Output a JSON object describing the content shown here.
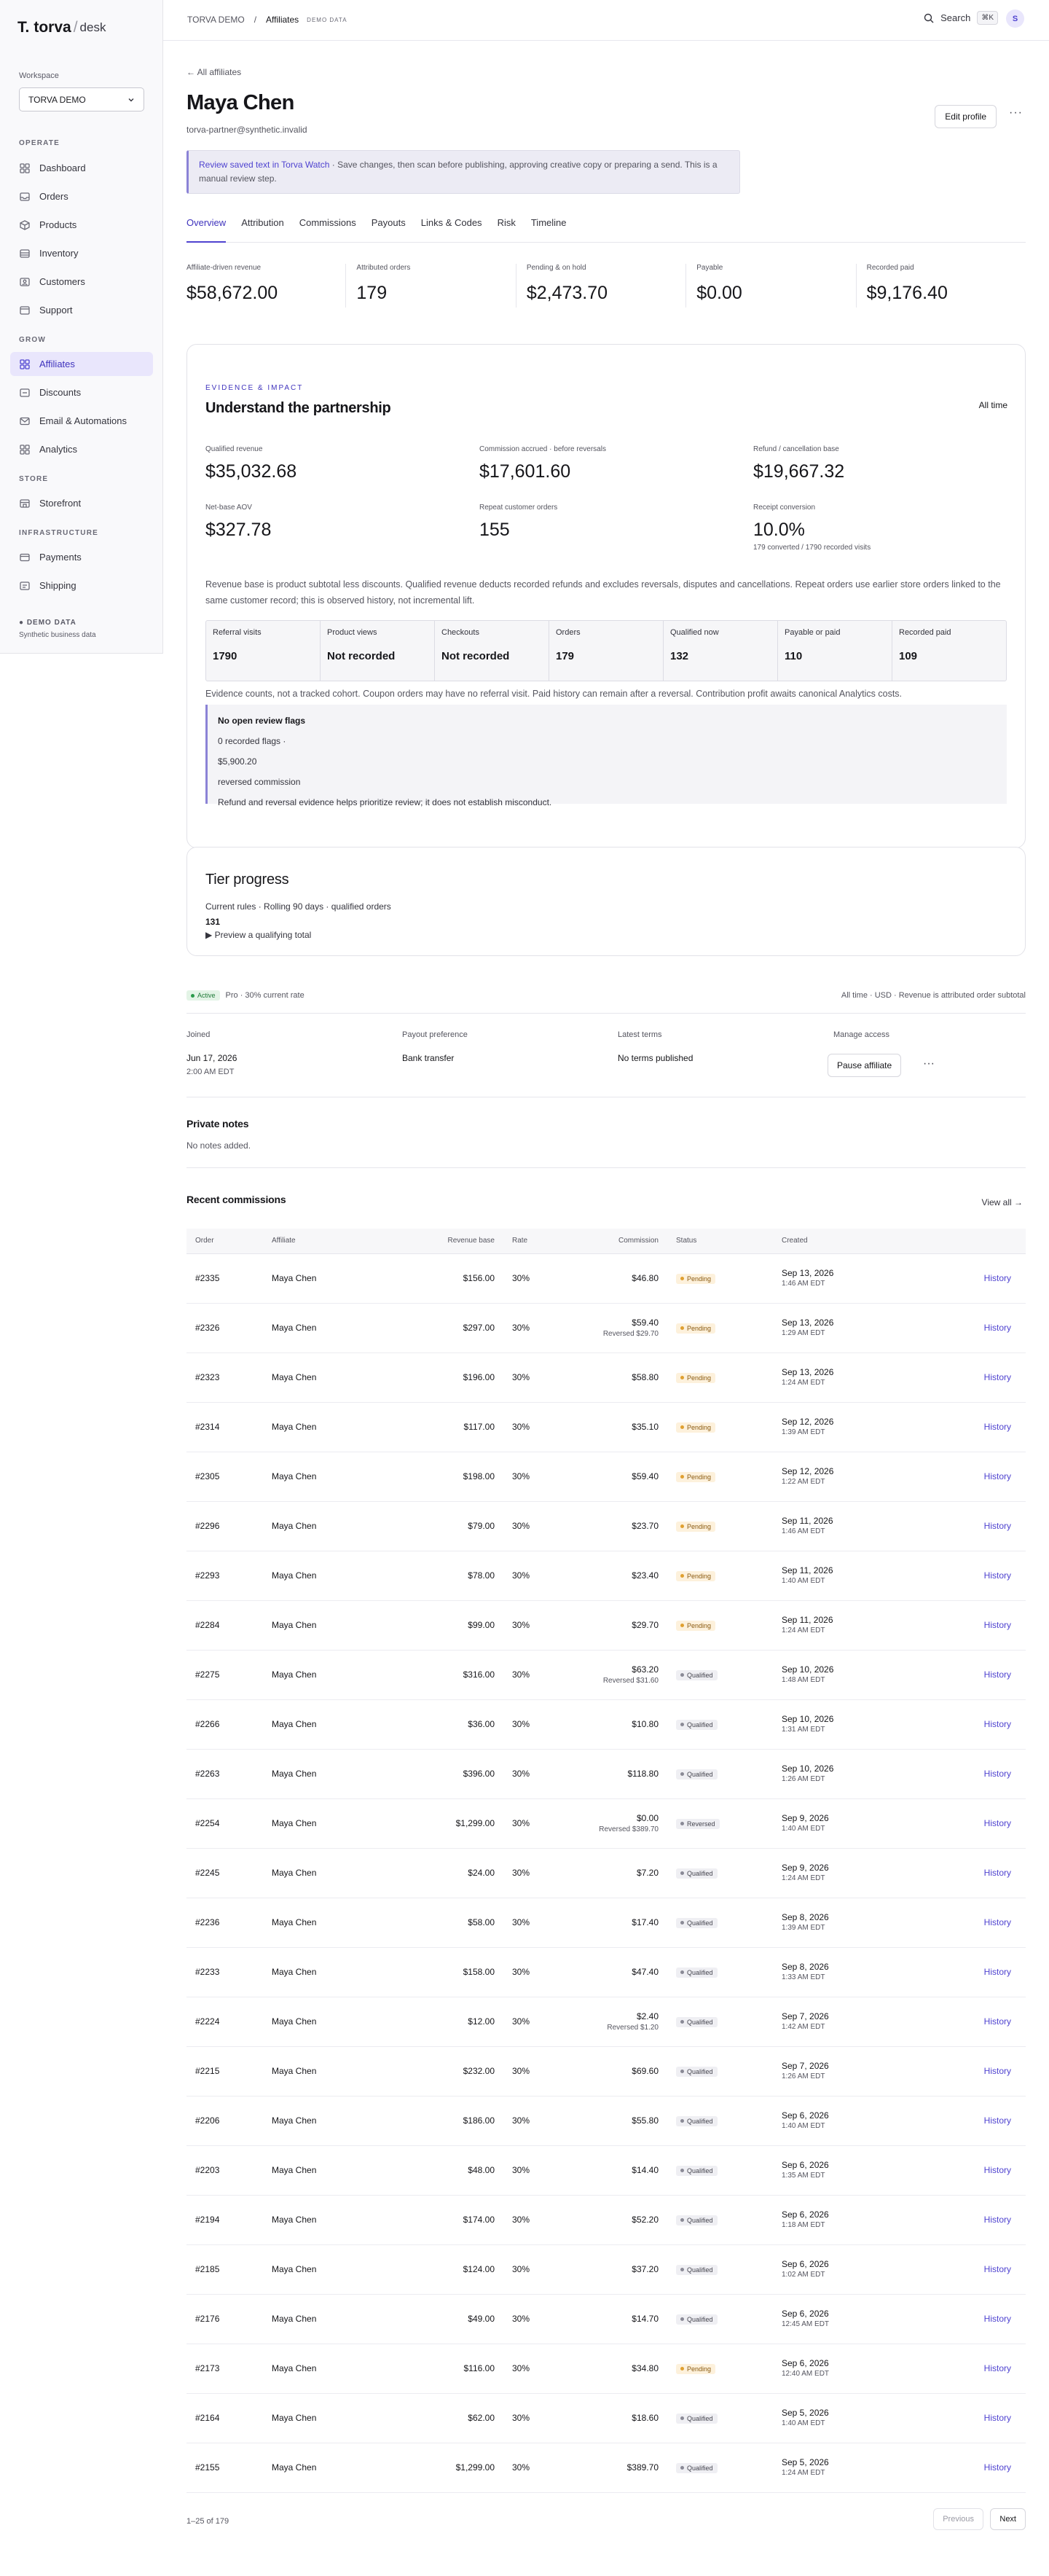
{
  "brand": {
    "mark": "T.",
    "name": "torva",
    "sep": "/",
    "product": "desk"
  },
  "workspace": {
    "label": "Workspace",
    "value": "TORVA DEMO"
  },
  "nav": {
    "operate": "OPERATE",
    "operate_items": [
      {
        "label": "Dashboard",
        "icon": "grid-icon"
      },
      {
        "label": "Orders",
        "icon": "inbox-icon"
      },
      {
        "label": "Products",
        "icon": "box-icon"
      },
      {
        "label": "Inventory",
        "icon": "layers-icon"
      },
      {
        "label": "Customers",
        "icon": "users-icon"
      },
      {
        "label": "Support",
        "icon": "support-icon"
      }
    ],
    "grow": "GROW",
    "grow_items": [
      {
        "label": "Affiliates",
        "icon": "grid-icon"
      },
      {
        "label": "Discounts",
        "icon": "tag-icon"
      },
      {
        "label": "Email & Automations",
        "icon": "mail-icon"
      },
      {
        "label": "Analytics",
        "icon": "chart-icon"
      }
    ],
    "store": "STORE",
    "store_items": [
      {
        "label": "Storefront",
        "icon": "store-icon"
      }
    ],
    "infra": "INFRASTRUCTURE",
    "infra_items": [
      {
        "label": "Payments",
        "icon": "card-icon"
      },
      {
        "label": "Shipping",
        "icon": "truck-icon"
      }
    ],
    "demo_badge": "● DEMO DATA",
    "demo_sub": "Synthetic business data"
  },
  "topbar": {
    "crumb_root": "TORVA DEMO",
    "crumb_sep": "/",
    "crumb_current": "Affiliates",
    "crumb_tag": "DEMO DATA",
    "search": "Search",
    "shortcut": "⌘K",
    "avatar": "S"
  },
  "profile": {
    "back": "← All affiliates",
    "name": "Maya Chen",
    "email": "torva-partner@synthetic.invalid",
    "edit": "Edit profile",
    "more": "···"
  },
  "notice": {
    "link": "Review saved text in Torva Watch",
    "text": " · Save changes, then scan before publishing, approving creative copy or preparing a send. This is a manual review step."
  },
  "tabs": [
    "Overview",
    "Attribution",
    "Commissions",
    "Payouts",
    "Links & Codes",
    "Risk",
    "Timeline"
  ],
  "stats": [
    {
      "label": "Affiliate-driven revenue",
      "value": "$58,672.00"
    },
    {
      "label": "Attributed orders",
      "value": "179"
    },
    {
      "label": "Pending & on hold",
      "value": "$2,473.70"
    },
    {
      "label": "Payable",
      "value": "$0.00"
    },
    {
      "label": "Recorded paid",
      "value": "$9,176.40"
    }
  ],
  "evidence": {
    "overline": "EVIDENCE & IMPACT",
    "title": "Understand the partnership",
    "range": "All time",
    "metrics": [
      {
        "label": "Qualified revenue",
        "value": "$35,032.68",
        "sub": ""
      },
      {
        "label": "Commission accrued · before reversals",
        "value": "$17,601.60",
        "sub": ""
      },
      {
        "label": "Refund / cancellation base",
        "value": "$19,667.32",
        "sub": ""
      },
      {
        "label": "Net-base AOV",
        "value": "$327.78",
        "sub": ""
      },
      {
        "label": "Repeat customer orders",
        "value": "155",
        "sub": ""
      },
      {
        "label": "Receipt conversion",
        "value": "10.0%",
        "sub": "179 converted / 1790 recorded visits"
      }
    ],
    "note": "Revenue base is product subtotal less discounts. Qualified revenue deducts recorded refunds and excludes reversals, disputes and cancellations. Repeat orders use earlier store orders linked to the same customer record; this is observed history, not incremental lift.",
    "funnel": [
      {
        "label": "Referral visits",
        "value": "1790"
      },
      {
        "label": "Product views",
        "value": "Not recorded"
      },
      {
        "label": "Checkouts",
        "value": "Not recorded"
      },
      {
        "label": "Orders",
        "value": "179"
      },
      {
        "label": "Qualified now",
        "value": "132"
      },
      {
        "label": "Payable or paid",
        "value": "110"
      },
      {
        "label": "Recorded paid",
        "value": "109"
      }
    ],
    "caveat": "Evidence counts, not a tracked cohort. Coupon orders may have no referral visit. Paid history can remain after a reversal. Contribution profit awaits canonical Analytics costs.",
    "review": {
      "title": "No open review flags",
      "flags": "0 recorded flags ·",
      "amount": "$5,900.20",
      "reversed": "reversed commission",
      "text": "Refund and reversal evidence helps prioritize review; it does not establish misconduct."
    }
  },
  "tier": {
    "title": "Tier progress",
    "rules": "Current rules · Rolling 90 days · qualified orders",
    "count": "131",
    "preview": "▶ Preview a qualifying total"
  },
  "status": {
    "badge": "Active",
    "plan": "Pro · 30% current rate",
    "right": "All time · USD · Revenue is attributed order subtotal"
  },
  "info": [
    {
      "label": "Joined",
      "value": "Jun 17, 2026",
      "value2": "2:00 AM EDT"
    },
    {
      "label": "Payout preference",
      "value": "Bank transfer",
      "value2": ""
    },
    {
      "label": "Latest terms",
      "value": "No terms published",
      "value2": ""
    },
    {
      "label": "Manage access",
      "value": "",
      "value2": ""
    }
  ],
  "pause": {
    "label": "Pause affiliate",
    "more": "···"
  },
  "notes": {
    "title": "Private notes",
    "empty": "No notes added."
  },
  "commissions": {
    "title": "Recent commissions",
    "view_all": "View all →",
    "headers": [
      "Order",
      "Affiliate",
      "Revenue base",
      "Rate",
      "Commission",
      "Status",
      "Created",
      ""
    ],
    "rows": [
      {
        "order": "#2335",
        "affiliate": "Maya Chen",
        "base": "$156.00",
        "rate": "30%",
        "commission": "$46.80",
        "reversed": "",
        "status": "Pending",
        "date": "Sep 13, 2026",
        "time": "1:46 AM EDT"
      },
      {
        "order": "#2326",
        "affiliate": "Maya Chen",
        "base": "$297.00",
        "rate": "30%",
        "commission": "$59.40",
        "reversed": "Reversed $29.70",
        "status": "Pending",
        "date": "Sep 13, 2026",
        "time": "1:29 AM EDT"
      },
      {
        "order": "#2323",
        "affiliate": "Maya Chen",
        "base": "$196.00",
        "rate": "30%",
        "commission": "$58.80",
        "reversed": "",
        "status": "Pending",
        "date": "Sep 13, 2026",
        "time": "1:24 AM EDT"
      },
      {
        "order": "#2314",
        "affiliate": "Maya Chen",
        "base": "$117.00",
        "rate": "30%",
        "commission": "$35.10",
        "reversed": "",
        "status": "Pending",
        "date": "Sep 12, 2026",
        "time": "1:39 AM EDT"
      },
      {
        "order": "#2305",
        "affiliate": "Maya Chen",
        "base": "$198.00",
        "rate": "30%",
        "commission": "$59.40",
        "reversed": "",
        "status": "Pending",
        "date": "Sep 12, 2026",
        "time": "1:22 AM EDT"
      },
      {
        "order": "#2296",
        "affiliate": "Maya Chen",
        "base": "$79.00",
        "rate": "30%",
        "commission": "$23.70",
        "reversed": "",
        "status": "Pending",
        "date": "Sep 11, 2026",
        "time": "1:46 AM EDT"
      },
      {
        "order": "#2293",
        "affiliate": "Maya Chen",
        "base": "$78.00",
        "rate": "30%",
        "commission": "$23.40",
        "reversed": "",
        "status": "Pending",
        "date": "Sep 11, 2026",
        "time": "1:40 AM EDT"
      },
      {
        "order": "#2284",
        "affiliate": "Maya Chen",
        "base": "$99.00",
        "rate": "30%",
        "commission": "$29.70",
        "reversed": "",
        "status": "Pending",
        "date": "Sep 11, 2026",
        "time": "1:24 AM EDT"
      },
      {
        "order": "#2275",
        "affiliate": "Maya Chen",
        "base": "$316.00",
        "rate": "30%",
        "commission": "$63.20",
        "reversed": "Reversed $31.60",
        "status": "Qualified",
        "date": "Sep 10, 2026",
        "time": "1:48 AM EDT"
      },
      {
        "order": "#2266",
        "affiliate": "Maya Chen",
        "base": "$36.00",
        "rate": "30%",
        "commission": "$10.80",
        "reversed": "",
        "status": "Qualified",
        "date": "Sep 10, 2026",
        "time": "1:31 AM EDT"
      },
      {
        "order": "#2263",
        "affiliate": "Maya Chen",
        "base": "$396.00",
        "rate": "30%",
        "commission": "$118.80",
        "reversed": "",
        "status": "Qualified",
        "date": "Sep 10, 2026",
        "time": "1:26 AM EDT"
      },
      {
        "order": "#2254",
        "affiliate": "Maya Chen",
        "base": "$1,299.00",
        "rate": "30%",
        "commission": "$0.00",
        "reversed": "Reversed $389.70",
        "status": "Reversed",
        "date": "Sep 9, 2026",
        "time": "1:40 AM EDT"
      },
      {
        "order": "#2245",
        "affiliate": "Maya Chen",
        "base": "$24.00",
        "rate": "30%",
        "commission": "$7.20",
        "reversed": "",
        "status": "Qualified",
        "date": "Sep 9, 2026",
        "time": "1:24 AM EDT"
      },
      {
        "order": "#2236",
        "affiliate": "Maya Chen",
        "base": "$58.00",
        "rate": "30%",
        "commission": "$17.40",
        "reversed": "",
        "status": "Qualified",
        "date": "Sep 8, 2026",
        "time": "1:39 AM EDT"
      },
      {
        "order": "#2233",
        "affiliate": "Maya Chen",
        "base": "$158.00",
        "rate": "30%",
        "commission": "$47.40",
        "reversed": "",
        "status": "Qualified",
        "date": "Sep 8, 2026",
        "time": "1:33 AM EDT"
      },
      {
        "order": "#2224",
        "affiliate": "Maya Chen",
        "base": "$12.00",
        "rate": "30%",
        "commission": "$2.40",
        "reversed": "Reversed $1.20",
        "status": "Qualified",
        "date": "Sep 7, 2026",
        "time": "1:42 AM EDT"
      },
      {
        "order": "#2215",
        "affiliate": "Maya Chen",
        "base": "$232.00",
        "rate": "30%",
        "commission": "$69.60",
        "reversed": "",
        "status": "Qualified",
        "date": "Sep 7, 2026",
        "time": "1:26 AM EDT"
      },
      {
        "order": "#2206",
        "affiliate": "Maya Chen",
        "base": "$186.00",
        "rate": "30%",
        "commission": "$55.80",
        "reversed": "",
        "status": "Qualified",
        "date": "Sep 6, 2026",
        "time": "1:40 AM EDT"
      },
      {
        "order": "#2203",
        "affiliate": "Maya Chen",
        "base": "$48.00",
        "rate": "30%",
        "commission": "$14.40",
        "reversed": "",
        "status": "Qualified",
        "date": "Sep 6, 2026",
        "time": "1:35 AM EDT"
      },
      {
        "order": "#2194",
        "affiliate": "Maya Chen",
        "base": "$174.00",
        "rate": "30%",
        "commission": "$52.20",
        "reversed": "",
        "status": "Qualified",
        "date": "Sep 6, 2026",
        "time": "1:18 AM EDT"
      },
      {
        "order": "#2185",
        "affiliate": "Maya Chen",
        "base": "$124.00",
        "rate": "30%",
        "commission": "$37.20",
        "reversed": "",
        "status": "Qualified",
        "date": "Sep 6, 2026",
        "time": "1:02 AM EDT"
      },
      {
        "order": "#2176",
        "affiliate": "Maya Chen",
        "base": "$49.00",
        "rate": "30%",
        "commission": "$14.70",
        "reversed": "",
        "status": "Qualified",
        "date": "Sep 6, 2026",
        "time": "12:45 AM EDT"
      },
      {
        "order": "#2173",
        "affiliate": "Maya Chen",
        "base": "$116.00",
        "rate": "30%",
        "commission": "$34.80",
        "reversed": "",
        "status": "Pending",
        "date": "Sep 6, 2026",
        "time": "12:40 AM EDT"
      },
      {
        "order": "#2164",
        "affiliate": "Maya Chen",
        "base": "$62.00",
        "rate": "30%",
        "commission": "$18.60",
        "reversed": "",
        "status": "Qualified",
        "date": "Sep 5, 2026",
        "time": "1:40 AM EDT"
      },
      {
        "order": "#2155",
        "affiliate": "Maya Chen",
        "base": "$1,299.00",
        "rate": "30%",
        "commission": "$389.70",
        "reversed": "",
        "status": "Qualified",
        "date": "Sep 5, 2026",
        "time": "1:24 AM EDT"
      }
    ],
    "history_label": "History",
    "pager": {
      "count": "1–25 of 179",
      "prev": "Previous",
      "next": "Next"
    }
  },
  "colors": {
    "accent": "#4f43d0",
    "pending": "#e0a030",
    "qualified": "#8a8a96",
    "active": "#2a9a4a"
  }
}
